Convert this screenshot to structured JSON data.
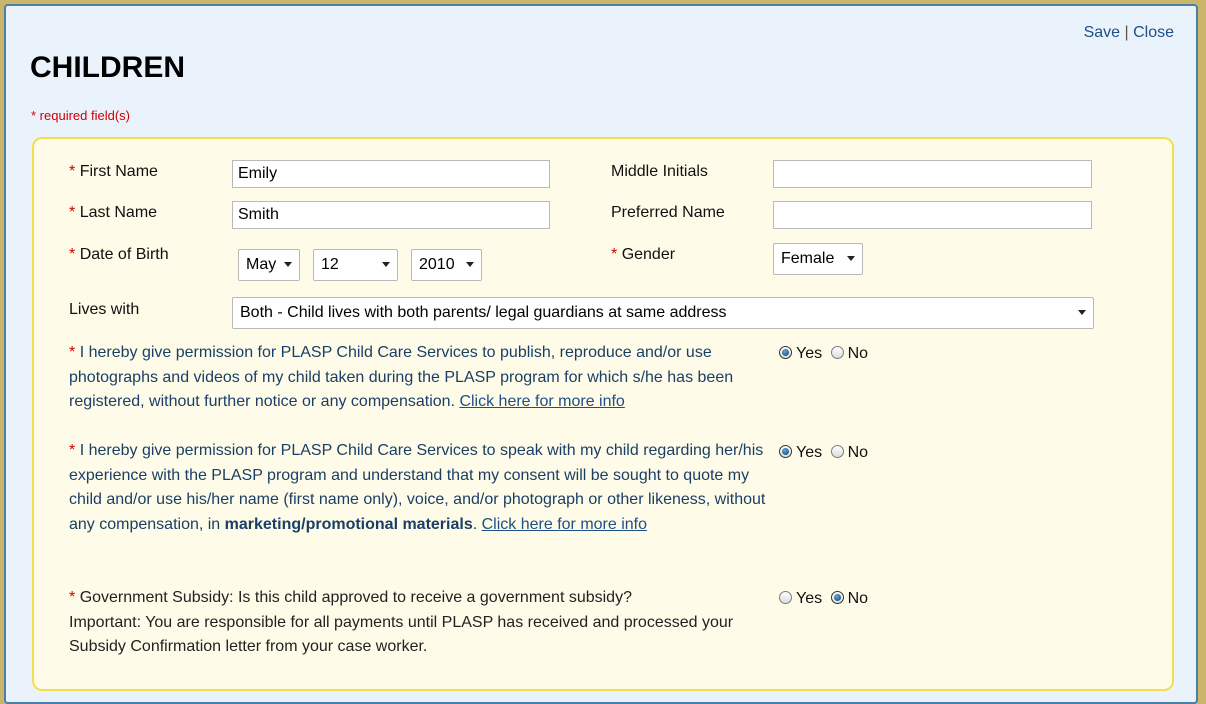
{
  "header": {
    "save_label": "Save",
    "separator": "|",
    "close_label": "Close",
    "title": "CHILDREN",
    "required_note": "* required field(s)"
  },
  "form": {
    "required_mark": "*",
    "first_name": {
      "label": "First Name",
      "value": "Emily"
    },
    "last_name": {
      "label": "Last Name",
      "value": "Smith"
    },
    "middle_initials": {
      "label": "Middle Initials",
      "value": ""
    },
    "preferred_name": {
      "label": "Preferred Name",
      "value": ""
    },
    "dob": {
      "label": "Date of Birth",
      "month": "May",
      "day": "12",
      "year": "2010"
    },
    "gender": {
      "label": "Gender",
      "value": "Female"
    },
    "lives_with": {
      "label": "Lives with",
      "value": "Both - Child lives with both parents/ legal guardians at same address"
    }
  },
  "consents": {
    "yes_label": "Yes",
    "no_label": "No",
    "photo": {
      "text": "I hereby give permission for PLASP Child Care Services to publish, reproduce and/or use photographs and videos of my child taken during the PLASP program for which s/he has been registered, without further notice or any compensation.",
      "link": "Click here for more info ",
      "selected": "Yes"
    },
    "speak": {
      "text_before": "I hereby give permission for PLASP Child Care Services to speak with my child regarding her/his experience with the PLASP program and understand that my consent will be sought to quote my child and/or use his/her name (first name only), voice, and/or photograph or other likeness, without any compensation, in",
      "bold": "marketing/promotional materials",
      "text_after": ".",
      "link": "Click here for more info ",
      "selected": "Yes"
    },
    "subsidy": {
      "question": "Government Subsidy: Is this child approved to receive a government subsidy?",
      "important": "Important: You are responsible for all payments until PLASP has received and processed your Subsidy Confirmation letter from your case worker.",
      "selected": "No"
    }
  },
  "colors": {
    "panel_bg": "#fefce8",
    "panel_border": "#f3df4e",
    "dialog_bg": "#eaf3fb",
    "required": "#d00000",
    "link": "#1e4f86"
  }
}
